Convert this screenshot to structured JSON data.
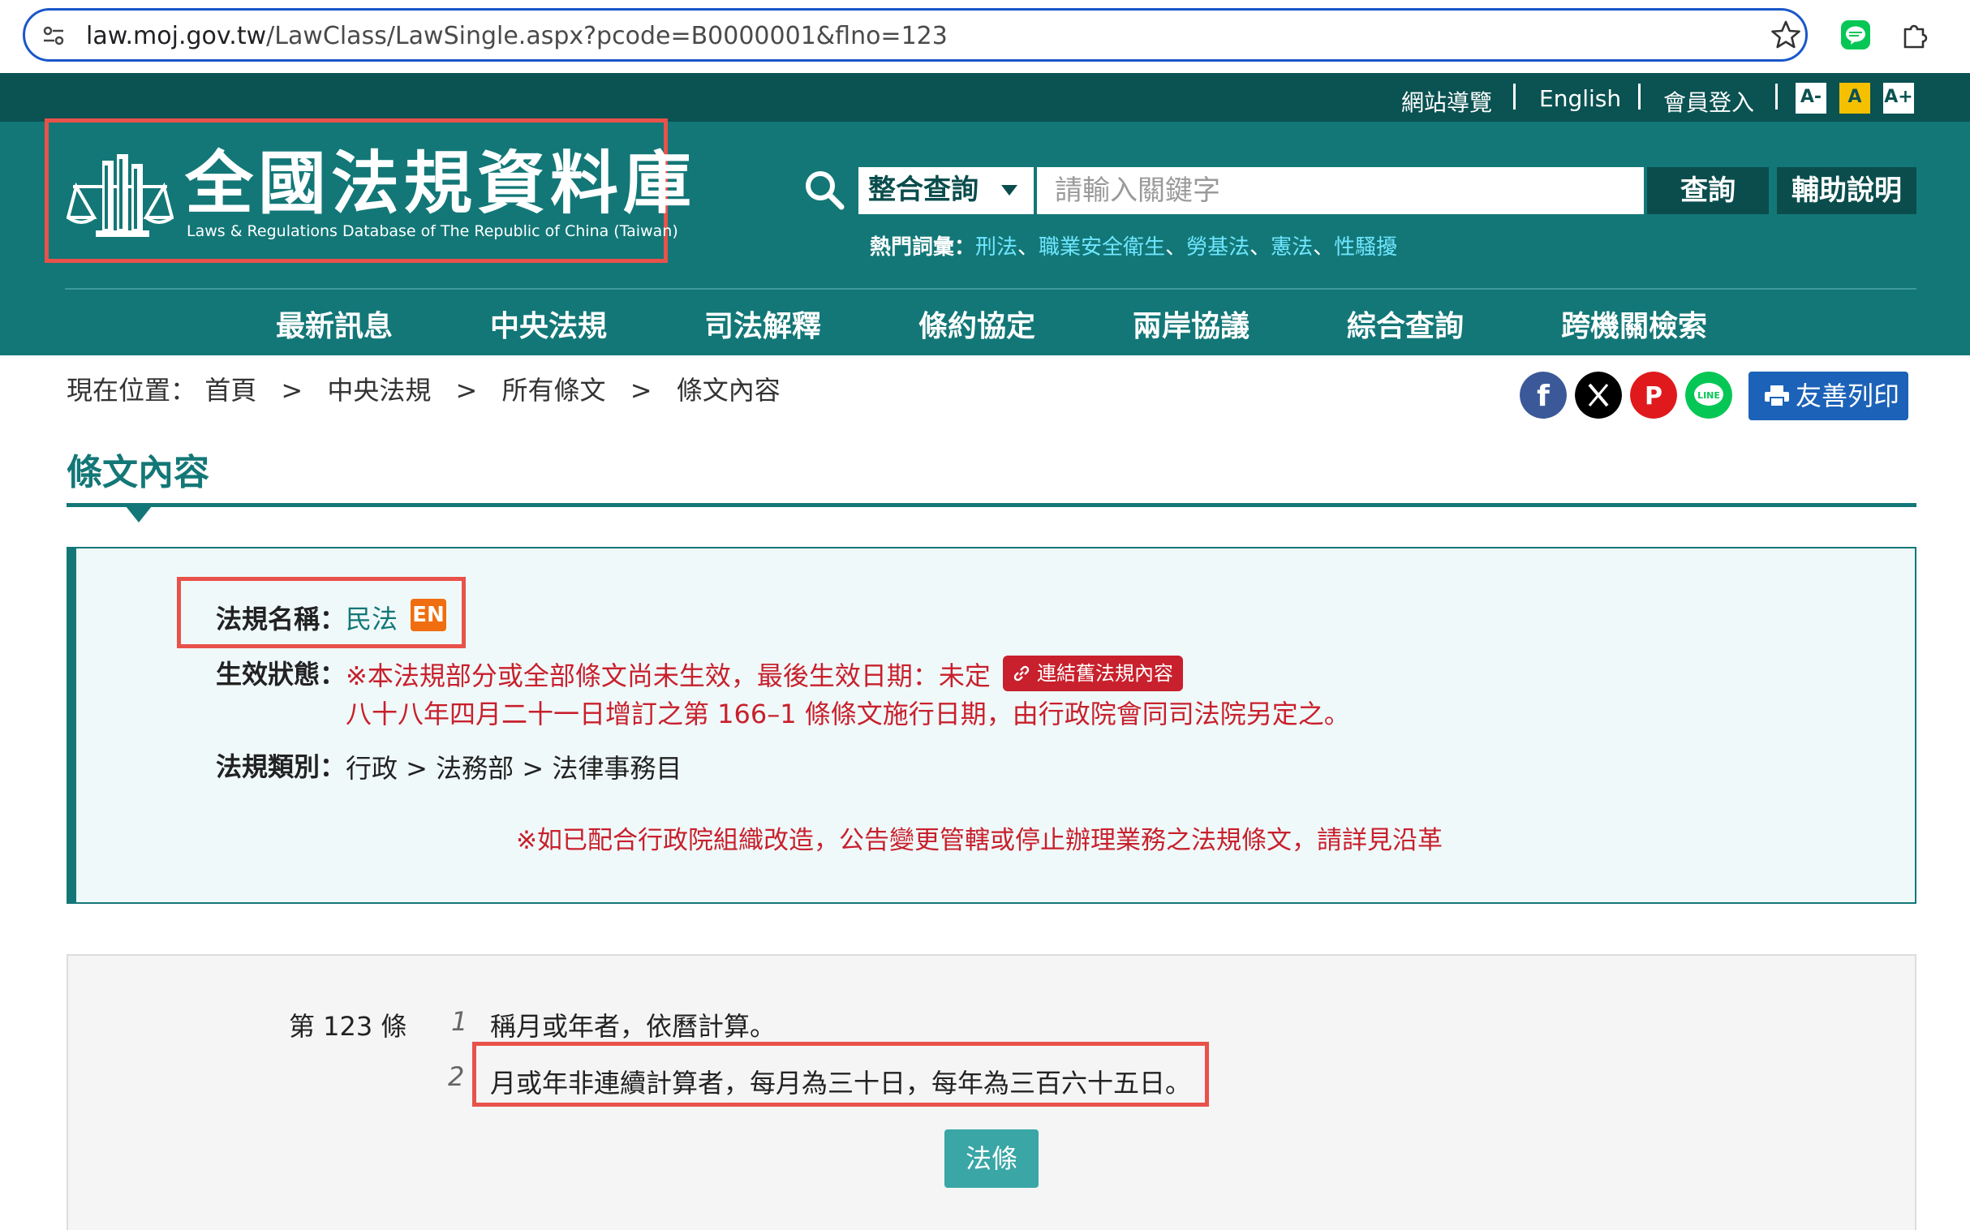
{
  "browser": {
    "url_host": "law.moj.gov.tw",
    "url_path": "/LawClass/LawSingle.aspx?pcode=B0000001&flno=123"
  },
  "topbar": {
    "sitemap": "網站導覽",
    "english": "English",
    "login": "會員登入",
    "font_small": "A-",
    "font_normal": "A",
    "font_large": "A+"
  },
  "header": {
    "logo_title": "全國法規資料庫",
    "logo_subtitle": "Laws & Regulations Database of The Republic of China (Taiwan)"
  },
  "search": {
    "type_selected": "整合查詢",
    "placeholder": "請輸入關鍵字",
    "query_label": "查詢",
    "help_label": "輔助說明",
    "hot_label": "熱門詞彙：",
    "hot_terms": [
      "刑法",
      "職業安全衛生",
      "勞基法",
      "憲法",
      "性騷擾"
    ],
    "hot_sep": "、"
  },
  "nav": [
    "最新訊息",
    "中央法規",
    "司法解釋",
    "條約協定",
    "兩岸協議",
    "綜合查詢",
    "跨機關檢索"
  ],
  "breadcrumb": {
    "label": "現在位置：",
    "sep": ">",
    "items": [
      "首頁",
      "中央法規",
      "所有條文",
      "條文內容"
    ]
  },
  "share": {
    "facebook_glyph": "f",
    "pinterest_glyph": "P",
    "line_glyph": "LINE",
    "print_label": "友善列印"
  },
  "page_title": "條文內容",
  "info": {
    "law_name_label": "法規名稱：",
    "law_name": "民法",
    "en_badge": "EN",
    "status_label": "生效狀態：",
    "status_line1": "※本法規部分或全部條文尚未生效，最後生效日期：未定",
    "old_link_label": "連結舊法規內容",
    "status_line2": "八十八年四月二十一日增訂之第 166–1  條條文施行日期，由行政院會同司法院另定之。",
    "category_label": "法規類別：",
    "category": "行政  >  法務部  >  法律事務目",
    "notice": "※如已配合行政院組織改造，公告變更管轄或停止辦理業務之法規條文，請詳見沿革"
  },
  "article": {
    "number": "第 123 條",
    "paragraphs": [
      {
        "no": "1",
        "text": "稱月或年者，依曆計算。"
      },
      {
        "no": "2",
        "text": "月或年非連續計算者，每月為三十日，每年為三百六十五日。"
      }
    ],
    "button_label": "法條"
  },
  "colors": {
    "header_teal": "#137777",
    "top_strip": "#0b5252",
    "button_dark": "#0b4d4d",
    "alert_red": "#c8202c",
    "highlight_box": "#e8524a",
    "en_badge": "#f06e10",
    "hot_link": "#6fe6ff",
    "print_blue": "#1b62b8",
    "law_button": "#3aa6a6"
  }
}
